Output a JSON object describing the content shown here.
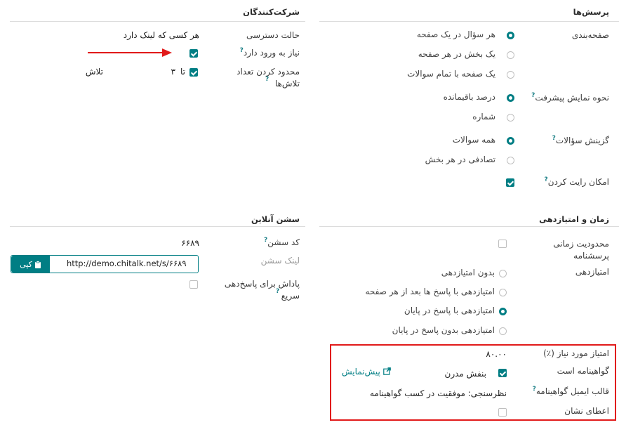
{
  "questions": {
    "title": "پرسش‌ها",
    "pagination_label": "صفحه‌بندی",
    "pagination_options": [
      "هر سؤال در یک صفحه",
      "یک بخش در هر صفحه",
      "یک صفحه با تمام سوالات"
    ],
    "pagination_selected": 0,
    "progress_label": "نحوه نمایش پیشرفت",
    "progress_options": [
      "درصد باقیمانده",
      "شماره"
    ],
    "progress_selected": 0,
    "selection_label": "گزینش سؤالات",
    "selection_options": [
      "همه سوالات",
      "تصادفی در هر بخش"
    ],
    "selection_selected": 0,
    "vote_label": "امکان رایت کردن",
    "vote_checked": true
  },
  "participants": {
    "title": "شرکت‌کنندگان",
    "access_label": "حالت دسترسی",
    "access_value": "هر کسی که لینک دارد",
    "login_label": "نیاز به ورود دارد",
    "login_checked": true,
    "limit_label": "محدود کردن تعداد تلاش‌ها",
    "limit_checked": true,
    "limit_prefix": "تا",
    "limit_count": "۳",
    "limit_suffix": "تلاش"
  },
  "live_session": {
    "title": "سشن آنلاین",
    "code_label": "کد سشن",
    "code_value": "۶۶۸۹",
    "link_label": "لینک سشن",
    "link_url": "http://demo.chitalk.net/s/۶۶۸۹",
    "copy_label": "کپی",
    "reward_label": "پاداش برای پاسخ‌دهی سریع",
    "reward_checked": false
  },
  "time_scoring": {
    "title": "زمان و امتیازدهی",
    "time_limit_label": "محدودیت زمانی پرسشنامه",
    "time_limit_checked": false,
    "scoring_label": "امتیازدهی",
    "scoring_options": [
      "بدون امتیازدهی",
      "امتیازدهی با پاسخ ها بعد از هر صفحه",
      "امتیازدهی با پاسخ در پایان",
      "امتیازدهی بدون پاسخ در پایان"
    ],
    "scoring_selected": 2,
    "required_score_label": "امتیاز مورد نیاز (٪)",
    "required_score_value": "۸۰.۰۰",
    "certification_label": "گواهینامه است",
    "certification_checked": true,
    "certification_template": "بنفش مدرن",
    "preview_label": "پیش‌نمایش",
    "email_template_label": "قالب ایمیل گواهینامه",
    "email_template_value": "نظرسنجی: موفقیت در کسب گواهینامه",
    "badge_label": "اعطای نشان",
    "badge_checked": false
  },
  "colors": {
    "accent": "#017e84",
    "highlight": "#e11a1a"
  },
  "icons": {
    "arrow": "red-arrow-icon",
    "copy": "clipboard-icon",
    "preview": "external-link-icon"
  }
}
